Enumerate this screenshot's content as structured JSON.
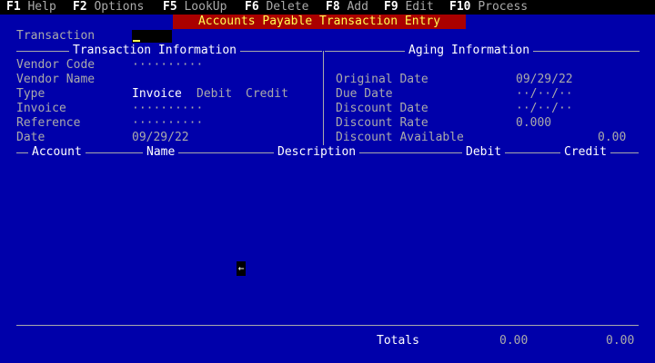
{
  "menu": [
    {
      "key": "F1",
      "label": "Help"
    },
    {
      "key": "F2",
      "label": "Options"
    },
    {
      "key": "F5",
      "label": "LookUp"
    },
    {
      "key": "F6",
      "label": "Delete"
    },
    {
      "key": "F8",
      "label": "Add"
    },
    {
      "key": "F9",
      "label": "Edit"
    },
    {
      "key": "F10",
      "label": "Process"
    }
  ],
  "window_title": "Accounts Payable Transaction Entry",
  "transaction_label": "Transaction",
  "sections": {
    "transaction_info": "Transaction Information",
    "aging_info": "Aging Information"
  },
  "left_fields": {
    "vendor_code": {
      "label": "Vendor Code",
      "value": "··········"
    },
    "vendor_name": {
      "label": "Vendor Name",
      "value": ""
    },
    "type": {
      "label": "Type",
      "options": [
        "Invoice",
        "Debit",
        "Credit"
      ],
      "selected": "Invoice"
    },
    "invoice": {
      "label": "Invoice",
      "value": "··········"
    },
    "reference": {
      "label": "Reference",
      "value": "··········"
    },
    "date": {
      "label": "Date",
      "value": "09/29/22"
    }
  },
  "right_fields": {
    "original_date": {
      "label": "Original Date",
      "value": "09/29/22"
    },
    "due_date": {
      "label": "Due Date",
      "value": "··/··/··"
    },
    "discount_date": {
      "label": "Discount Date",
      "value": "··/··/··"
    },
    "discount_rate": {
      "label": "Discount Rate",
      "value": "0.000"
    },
    "discount_available": {
      "label": "Discount Available",
      "value": "0.00"
    }
  },
  "columns": [
    "Account",
    "Name",
    "Description",
    "Debit",
    "Credit"
  ],
  "totals": {
    "label": "Totals",
    "debit": "0.00",
    "credit": "0.00"
  },
  "mouse_pointer_glyph": "←",
  "colors": {
    "background": "#0000aa",
    "title_bg": "#aa0000",
    "title_fg": "#ffff55",
    "menubar_bg": "#000000"
  }
}
